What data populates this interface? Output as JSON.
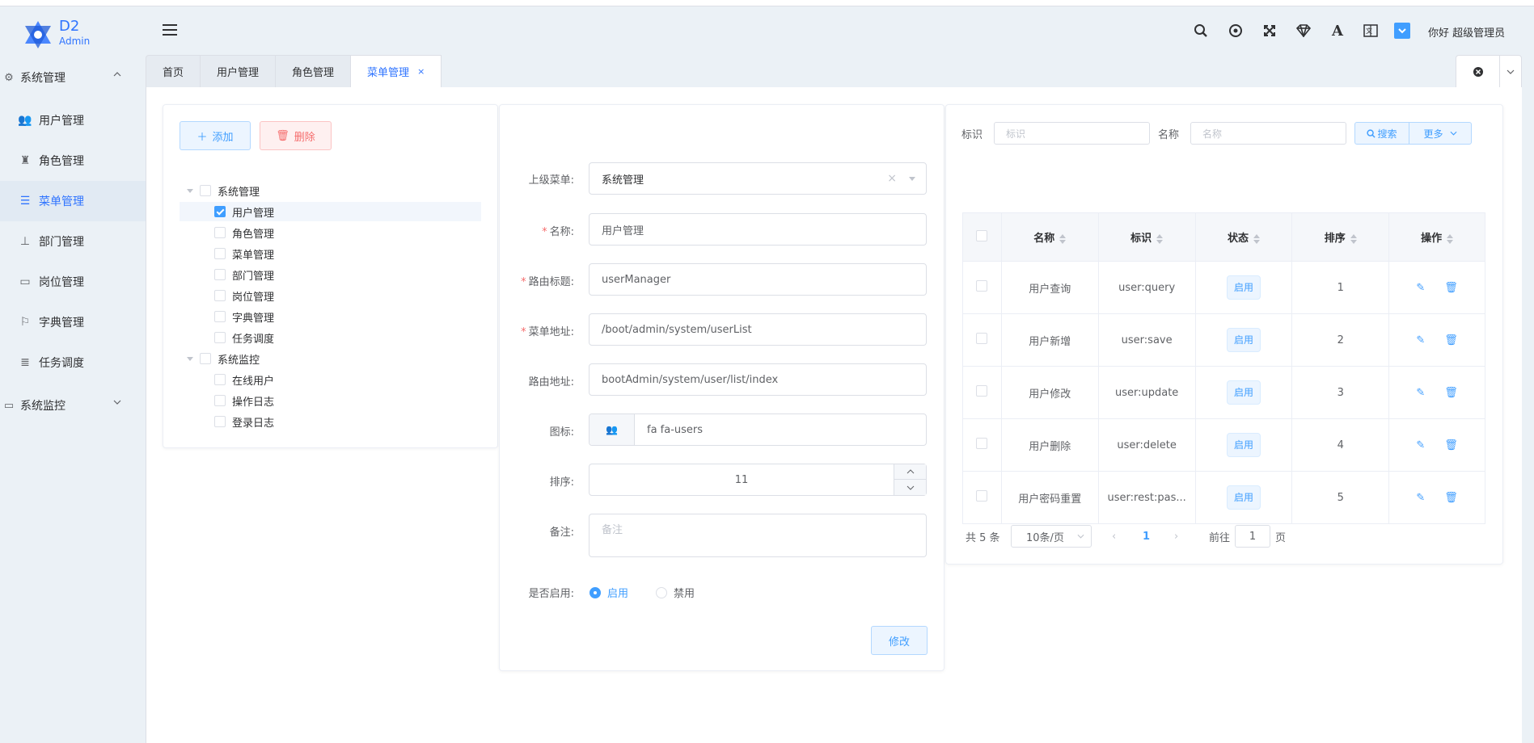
{
  "app": {
    "logo_main": "D2",
    "logo_sub": "Admin"
  },
  "sidebar": {
    "group1": "系统管理",
    "items": [
      "用户管理",
      "角色管理",
      "菜单管理",
      "部门管理",
      "岗位管理",
      "字典管理",
      "任务调度"
    ],
    "group2": "系统监控",
    "active_index": 2
  },
  "header": {
    "greeting": "你好 超级管理员"
  },
  "tabs": [
    {
      "label": "首页"
    },
    {
      "label": "用户管理"
    },
    {
      "label": "角色管理"
    },
    {
      "label": "菜单管理",
      "active": true,
      "close": "×"
    }
  ],
  "tree": {
    "add_label": "添加",
    "delete_label": "删除",
    "nodes": [
      {
        "label": "系统管理",
        "level": 0,
        "checked": false
      },
      {
        "label": "用户管理",
        "level": 1,
        "checked": true,
        "selected": true
      },
      {
        "label": "角色管理",
        "level": 1,
        "checked": false
      },
      {
        "label": "菜单管理",
        "level": 1,
        "checked": false
      },
      {
        "label": "部门管理",
        "level": 1,
        "checked": false
      },
      {
        "label": "岗位管理",
        "level": 1,
        "checked": false
      },
      {
        "label": "字典管理",
        "level": 1,
        "checked": false
      },
      {
        "label": "任务调度",
        "level": 1,
        "checked": false
      },
      {
        "label": "系统监控",
        "level": 0,
        "checked": false
      },
      {
        "label": "在线用户",
        "level": 1,
        "checked": false
      },
      {
        "label": "操作日志",
        "level": 1,
        "checked": false
      },
      {
        "label": "登录日志",
        "level": 1,
        "checked": false
      }
    ]
  },
  "form": {
    "parent_label": "上级菜单:",
    "parent_value": "系统管理",
    "name_label": "名称:",
    "name_value": "用户管理",
    "route_title_label": "路由标题:",
    "route_title_value": "userManager",
    "menu_url_label": "菜单地址:",
    "menu_url_value": "/boot/admin/system/userList",
    "route_path_label": "路由地址:",
    "route_path_value": "bootAdmin/system/user/list/index",
    "icon_label": "图标:",
    "icon_value": "fa fa-users",
    "order_label": "排序:",
    "order_value": "11",
    "remark_label": "备注:",
    "remark_placeholder": "备注",
    "enabled_label": "是否启用:",
    "enabled_on": "启用",
    "enabled_off": "禁用",
    "submit_label": "修改"
  },
  "search": {
    "ident_label": "标识",
    "ident_placeholder": "标识",
    "name_label": "名称",
    "name_placeholder": "名称",
    "search_btn": "搜索",
    "more_btn": "更多"
  },
  "table": {
    "columns": [
      "名称",
      "标识",
      "状态",
      "排序",
      "操作"
    ],
    "rows": [
      {
        "name": "用户查询",
        "ident": "user:query",
        "status": "启用",
        "order": "1"
      },
      {
        "name": "用户新增",
        "ident": "user:save",
        "status": "启用",
        "order": "2"
      },
      {
        "name": "用户修改",
        "ident": "user:update",
        "status": "启用",
        "order": "3"
      },
      {
        "name": "用户删除",
        "ident": "user:delete",
        "status": "启用",
        "order": "4"
      },
      {
        "name": "用户密码重置",
        "ident": "user:rest:pas...",
        "status": "启用",
        "order": "5"
      }
    ]
  },
  "pager": {
    "total": "共 5 条",
    "page_size": "10条/页",
    "current": "1",
    "goto_prefix": "前往",
    "goto_value": "1",
    "goto_suffix": "页"
  },
  "colors": {
    "accent": "#409eff",
    "danger": "#f56c6c",
    "sidebar_bg": "#ebf1f6"
  }
}
